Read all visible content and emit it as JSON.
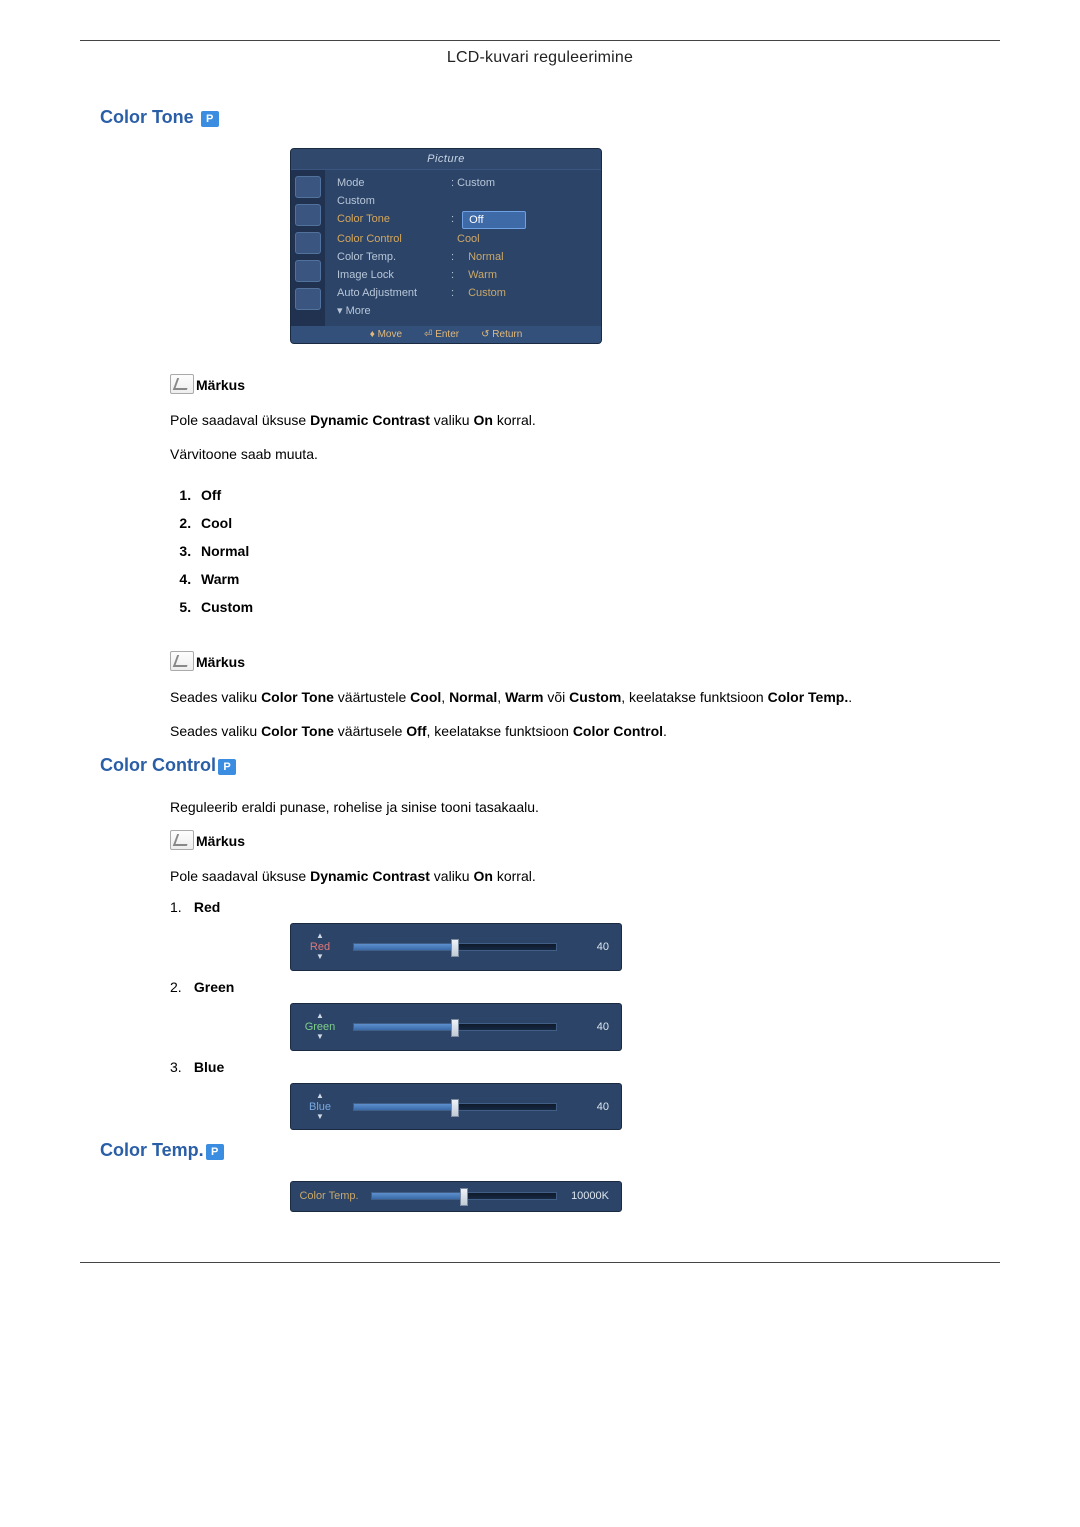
{
  "header": {
    "title": "LCD-kuvari reguleerimine"
  },
  "sections": {
    "color_tone": {
      "title": "Color Tone"
    },
    "color_control": {
      "title": "Color Control"
    },
    "color_temp": {
      "title": "Color Temp."
    }
  },
  "note_label": "Märkus",
  "color_tone": {
    "text_not_available_pre": "Pole saadaval üksuse ",
    "dynamic_contrast": "Dynamic Contrast",
    "text_not_available_mid": " valiku ",
    "on": "On",
    "text_not_available_post": " korral.",
    "text_change": "Värvitoone saab muuta.",
    "options": [
      "Off",
      "Cool",
      "Normal",
      "Warm",
      "Custom"
    ],
    "note2_pre": "Seades valiku ",
    "note2_ct": "Color Tone",
    "note2_mid1": " väärtustele ",
    "note2_cool": "Cool",
    "note2_c1": ", ",
    "note2_normal": "Normal",
    "note2_c2": ", ",
    "note2_warm": "Warm",
    "note2_or": " või ",
    "note2_custom": "Custom",
    "note2_tail": ", keelatakse funktsioon ",
    "note2_ctemp": "Color Temp.",
    "note2_end": ".",
    "note3_pre": "Seades valiku ",
    "note3_ct": "Color Tone",
    "note3_mid": " väärtusele ",
    "note3_off": "Off",
    "note3_tail": ", keelatakse funktsioon ",
    "note3_cc": "Color Control",
    "note3_end": "."
  },
  "color_control": {
    "intro": "Reguleerib eraldi punase, rohelise ja sinise tooni tasakaalu.",
    "na_pre": "Pole saadaval üksuse ",
    "na_dc": "Dynamic Contrast",
    "na_mid": " valiku ",
    "na_on": "On",
    "na_post": " korral.",
    "items": [
      {
        "num": "1.",
        "label": "Red",
        "slider_label": "Red",
        "value": "40"
      },
      {
        "num": "2.",
        "label": "Green",
        "slider_label": "Green",
        "value": "40"
      },
      {
        "num": "3.",
        "label": "Blue",
        "slider_label": "Blue",
        "value": "40"
      }
    ]
  },
  "color_temp": {
    "slider_label": "Color Temp.",
    "value": "10000K"
  },
  "osd": {
    "title": "Picture",
    "rows": {
      "mode": {
        "label": "Mode",
        "value": ": Custom"
      },
      "custom": {
        "label": "Custom"
      },
      "color_tone": {
        "label": "Color Tone",
        "value_selected": "Off"
      },
      "color_control": {
        "label": "Color Control",
        "opt": "Cool"
      },
      "color_temp": {
        "label": "Color Temp.",
        "opt": "Normal"
      },
      "image_lock": {
        "label": "Image Lock",
        "opt": "Warm"
      },
      "auto_adjustment": {
        "label": "Auto Adjustment",
        "opt": "Custom"
      },
      "more": {
        "label": "▾ More"
      }
    },
    "footer": {
      "move": "Move",
      "enter": "Enter",
      "return": "Return"
    }
  }
}
